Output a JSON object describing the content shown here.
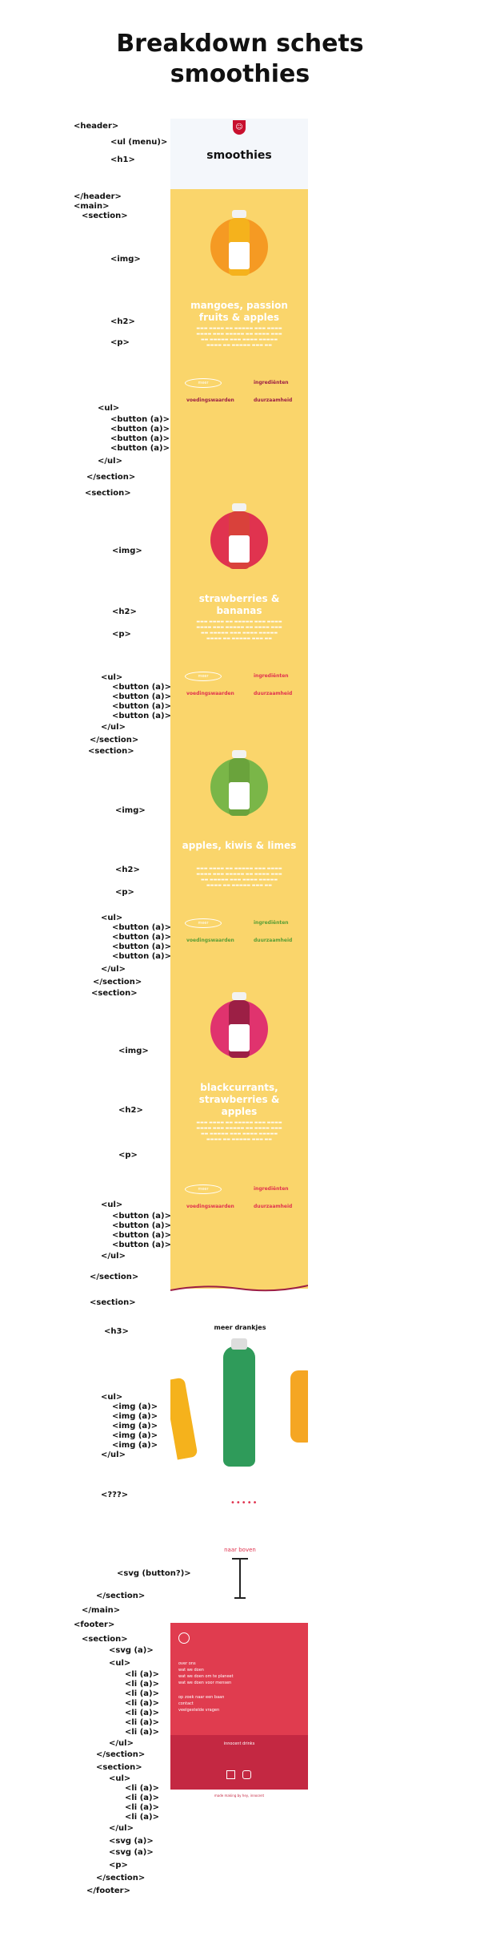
{
  "title_line1": "Breakdown schets",
  "title_line2": "smoothies",
  "tags": [
    "<header>",
    "<ul (menu)>",
    "<h1>",
    "</header>",
    "<main>",
    "<section>",
    "<img>",
    "<h2>",
    "<p>",
    "<ul>",
    "<button (a)>",
    "<button (a)>",
    "<button (a)>",
    "<button (a)>",
    "</ul>",
    "</section>",
    "<section>",
    "<img>",
    "<h2>",
    "<p>",
    "<ul>",
    "<button (a)>",
    "<button (a)>",
    "<button (a)>",
    "<button (a)>",
    "</ul>",
    "</section>",
    "<section>",
    "<img>",
    "<h2>",
    "<p>",
    "<ul>",
    "<button (a)>",
    "<button (a)>",
    "<button (a)>",
    "<button (a)>",
    "</ul>",
    "</section>",
    "<section>",
    "<img>",
    "<h2>",
    "<p>",
    "<ul>",
    "<button (a)>",
    "<button (a)>",
    "<button (a)>",
    "<button (a)>",
    "</ul>",
    "</section>",
    "<section>",
    "<h3>",
    "<ul>",
    "<img (a)>",
    "<img (a)>",
    "<img (a)>",
    "<img (a)>",
    "<img (a)>",
    "</ul>",
    "<???>",
    "<svg (button?)>",
    "</section>",
    "</main>",
    "<footer>",
    "<section>",
    "<svg (a)>",
    "<ul>",
    "<li (a)>",
    "<li (a)>",
    "<li (a)>",
    "<li (a)>",
    "<li (a)>",
    "<li (a)>",
    "<li (a)>",
    "</ul>",
    "</section>",
    "<section>",
    "<ul>",
    "<li (a)>",
    "<li (a)>",
    "<li (a)>",
    "<li (a)>",
    "</ul>",
    "<svg (a)>",
    "<svg (a)>",
    "<p>",
    "</section>",
    "</footer>"
  ],
  "mockup": {
    "h1": "smoothies",
    "products": [
      {
        "name": "mangoes, passion fruits & apples",
        "circle": "#f59a23",
        "bottle": "#f5b21c",
        "accent": "#ffffff"
      },
      {
        "name": "strawberries & bananas",
        "circle": "#e0334f",
        "bottle": "#d9413b",
        "accent": "#e0334f"
      },
      {
        "name": "apples, kiwis & limes",
        "circle": "#7ab648",
        "bottle": "#6aa33c",
        "accent": "#5a9e35"
      },
      {
        "name": "blackcurrants, strawberries & apples",
        "circle": "#e0336e",
        "bottle": "#9c1f45",
        "accent": "#e0334f"
      }
    ],
    "buttons": {
      "ingredienten": "ingrediënten",
      "voedingswaarden": "voedingswaarden",
      "duurzaamheid": "duurzaamheid",
      "meer": "meer"
    },
    "meer_drankjes": "meer drankjes",
    "dots": "•••••",
    "naar_boven": "naar boven",
    "footer": {
      "links1": [
        "over ons",
        "wat we doen",
        "wat we doen om te planeet",
        "wat we doen voor mensen",
        "op zoek naar een baan",
        "contact",
        "veelgestelde vragen"
      ],
      "address": "innocent drinks",
      "copyright": "made making by hey, innocent"
    }
  },
  "colors": {
    "yellow": "#fad56b",
    "red": "#e03c4f",
    "darkred": "#c42842"
  }
}
